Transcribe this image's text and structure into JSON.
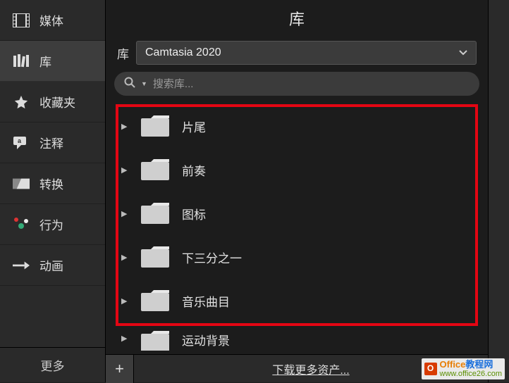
{
  "sidebar": {
    "items": [
      {
        "label": "媒体",
        "icon": "film-icon"
      },
      {
        "label": "库",
        "icon": "books-icon"
      },
      {
        "label": "收藏夹",
        "icon": "star-icon"
      },
      {
        "label": "注释",
        "icon": "callout-icon"
      },
      {
        "label": "转换",
        "icon": "transition-icon"
      },
      {
        "label": "行为",
        "icon": "behavior-icon"
      },
      {
        "label": "动画",
        "icon": "animation-icon"
      }
    ],
    "more_label": "更多"
  },
  "main": {
    "title": "库",
    "library_label": "库",
    "library_selected": "Camtasia 2020",
    "search_placeholder": "搜索库...",
    "folders": [
      {
        "label": "片尾"
      },
      {
        "label": "前奏"
      },
      {
        "label": "图标"
      },
      {
        "label": "下三分之一"
      },
      {
        "label": "音乐曲目"
      },
      {
        "label": "运动背景"
      }
    ],
    "add_label": "+",
    "download_label": "下载更多资产..."
  },
  "watermark": {
    "line1a": "Office",
    "line1b": "教程网",
    "line2": "www.office26.com"
  }
}
